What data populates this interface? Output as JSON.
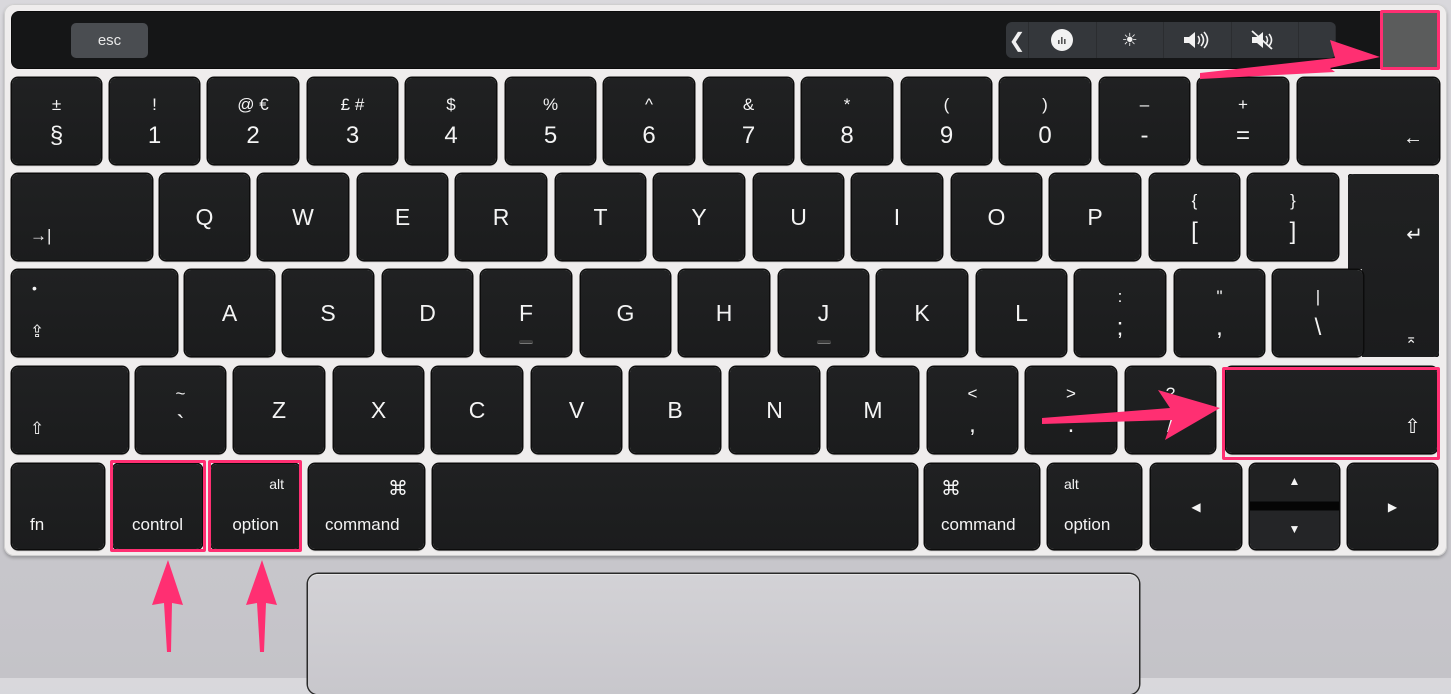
{
  "annotation_color": "#ff2f72",
  "touch_bar": {
    "esc_label": "esc",
    "control_strip": [
      {
        "icon": "chevron-left-icon",
        "glyph": "❮"
      },
      {
        "icon": "siri-icon",
        "glyph": "◉"
      },
      {
        "icon": "brightness-icon",
        "glyph": "☀"
      },
      {
        "icon": "volume-icon",
        "glyph": "🔊"
      },
      {
        "icon": "mute-icon",
        "glyph": "🔇"
      },
      {
        "icon": "siri-partial-icon",
        "glyph": "◐"
      }
    ],
    "touch_id_highlighted": true
  },
  "rows": {
    "number": [
      {
        "top": "±",
        "bottom": "§"
      },
      {
        "top": "!",
        "bottom": "1"
      },
      {
        "top": "@ €",
        "bottom": "2"
      },
      {
        "top": "£ #",
        "bottom": "3"
      },
      {
        "top": "$",
        "bottom": "4"
      },
      {
        "top": "%",
        "bottom": "5"
      },
      {
        "top": "^",
        "bottom": "6"
      },
      {
        "top": "&",
        "bottom": "7"
      },
      {
        "top": "*",
        "bottom": "8"
      },
      {
        "top": "(",
        "bottom": "9"
      },
      {
        "top": ")",
        "bottom": "0"
      },
      {
        "top": "–",
        "bottom": "-"
      },
      {
        "top": "+",
        "bottom": "="
      },
      {
        "label": "←"
      }
    ],
    "qwerty": [
      {
        "label": "→|"
      },
      {
        "label": "Q"
      },
      {
        "label": "W"
      },
      {
        "label": "E"
      },
      {
        "label": "R"
      },
      {
        "label": "T"
      },
      {
        "label": "Y"
      },
      {
        "label": "U"
      },
      {
        "label": "I"
      },
      {
        "label": "O"
      },
      {
        "label": "P"
      },
      {
        "top": "{",
        "bottom": "["
      },
      {
        "top": "}",
        "bottom": "]"
      },
      {
        "label": "↵"
      }
    ],
    "home": [
      {
        "label": "⇪",
        "dot": "•"
      },
      {
        "label": "A"
      },
      {
        "label": "S"
      },
      {
        "label": "D"
      },
      {
        "label": "F"
      },
      {
        "label": "G"
      },
      {
        "label": "H"
      },
      {
        "label": "J"
      },
      {
        "label": "K"
      },
      {
        "label": "L"
      },
      {
        "top": ":",
        "bottom": ";"
      },
      {
        "top": "\"",
        "bottom": ","
      },
      {
        "top": "|",
        "bottom": "\\"
      },
      {
        "label": "⌅"
      }
    ],
    "shift": [
      {
        "label": "⇧"
      },
      {
        "top": "~",
        "bottom": "`"
      },
      {
        "label": "Z"
      },
      {
        "label": "X"
      },
      {
        "label": "C"
      },
      {
        "label": "V"
      },
      {
        "label": "B"
      },
      {
        "label": "N"
      },
      {
        "label": "M"
      },
      {
        "top": "<",
        "bottom": ","
      },
      {
        "top": ">",
        "bottom": "."
      },
      {
        "top": "?",
        "bottom": "/"
      },
      {
        "label": "⇧"
      }
    ],
    "bottom": [
      {
        "label": "fn"
      },
      {
        "label": "control"
      },
      {
        "label": "option",
        "sub": "alt"
      },
      {
        "label": "command",
        "sub": "⌘"
      },
      {
        "label": ""
      },
      {
        "label": "command",
        "sub": "⌘"
      },
      {
        "label": "option",
        "sub": "alt"
      },
      {
        "label": "◀"
      },
      {
        "up": "▲",
        "down": "▼"
      },
      {
        "label": "▶"
      }
    ]
  },
  "highlights": [
    "touch-id-key",
    "right-shift-key",
    "left-control-key",
    "left-option-key"
  ]
}
